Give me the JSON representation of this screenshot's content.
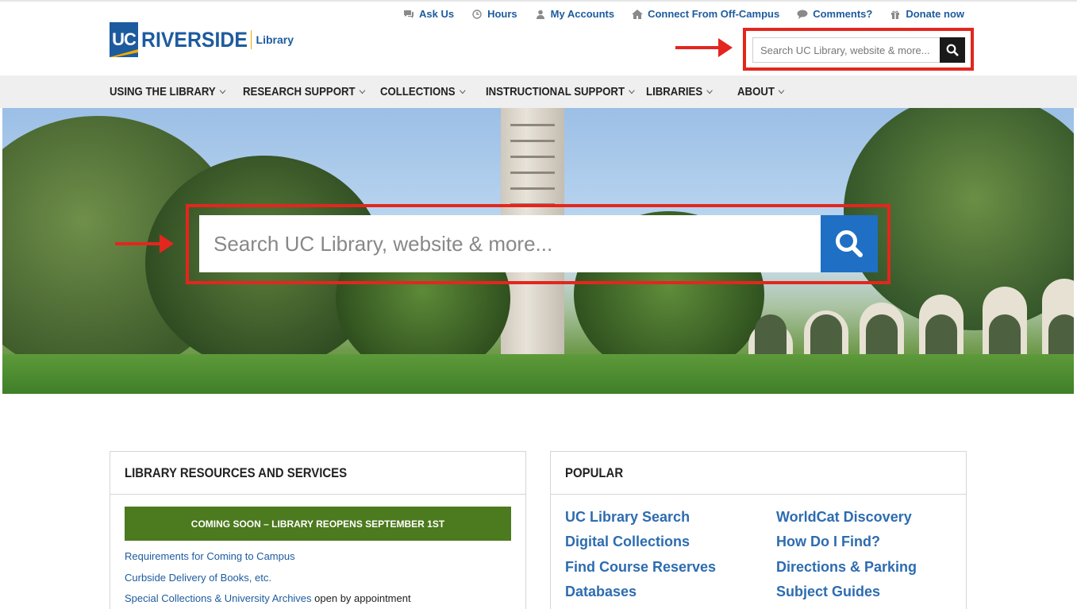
{
  "header": {
    "logo_uc": "UC",
    "logo_riverside": "RIVERSIDE",
    "logo_library": "Library",
    "utility_links": [
      {
        "label": "Ask Us",
        "icon": "chat-icon"
      },
      {
        "label": "Hours",
        "icon": "clock-icon"
      },
      {
        "label": "My Accounts",
        "icon": "user-icon"
      },
      {
        "label": "Connect From Off-Campus",
        "icon": "home-icon"
      },
      {
        "label": "Comments?",
        "icon": "comment-icon"
      },
      {
        "label": "Donate now",
        "icon": "gift-icon"
      }
    ],
    "search_placeholder": "Search UC Library, website & more..."
  },
  "nav": {
    "items": [
      {
        "label": "USING THE LIBRARY"
      },
      {
        "label": "RESEARCH SUPPORT"
      },
      {
        "label": "COLLECTIONS"
      },
      {
        "label": "INSTRUCTIONAL SUPPORT"
      },
      {
        "label": "LIBRARIES"
      },
      {
        "label": "ABOUT"
      }
    ]
  },
  "hero": {
    "search_placeholder": "Search UC Library, website & more..."
  },
  "resources": {
    "title": "LIBRARY RESOURCES AND SERVICES",
    "banner": "COMING SOON – LIBRARY REOPENS SEPTEMBER 1ST",
    "links": [
      {
        "label": "Requirements for Coming to Campus"
      },
      {
        "label": "Curbside Delivery of Books, etc."
      },
      {
        "label": "Special Collections & University Archives",
        "suffix": " open by appointment"
      }
    ]
  },
  "popular": {
    "title": "POPULAR",
    "left": [
      "UC Library Search",
      "Digital Collections",
      "Find Course Reserves",
      "Databases"
    ],
    "right": [
      "WorldCat Discovery",
      "How Do I Find?",
      "Directions & Parking",
      "Subject Guides"
    ]
  },
  "colors": {
    "brand_blue": "#1d5b9f",
    "brand_gold": "#f1ab00",
    "highlight_red": "#e3261e",
    "banner_green": "#4c7a1f",
    "search_button_blue": "#1f6fc5"
  }
}
